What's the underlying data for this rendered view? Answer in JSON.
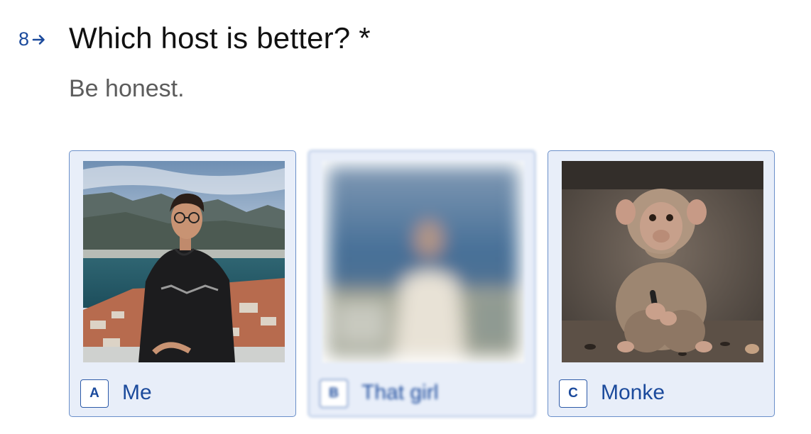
{
  "question": {
    "number": "8",
    "title": "Which host is better? *",
    "description": "Be honest."
  },
  "choices": [
    {
      "key": "A",
      "label": "Me",
      "image": "man-on-mountain-photo",
      "blurred": false
    },
    {
      "key": "B",
      "label": "That girl",
      "image": "blurred-person-photo",
      "blurred": true
    },
    {
      "key": "C",
      "label": "Monke",
      "image": "monkey-photo",
      "blurred": false
    }
  ],
  "icons": {
    "arrow": "arrow-right-icon"
  },
  "colors": {
    "accent": "#1b4a9c",
    "card_border": "#6a8fc9",
    "card_background": "#e8eef9",
    "title_text": "#111111",
    "description_text": "#5c5c5c"
  }
}
